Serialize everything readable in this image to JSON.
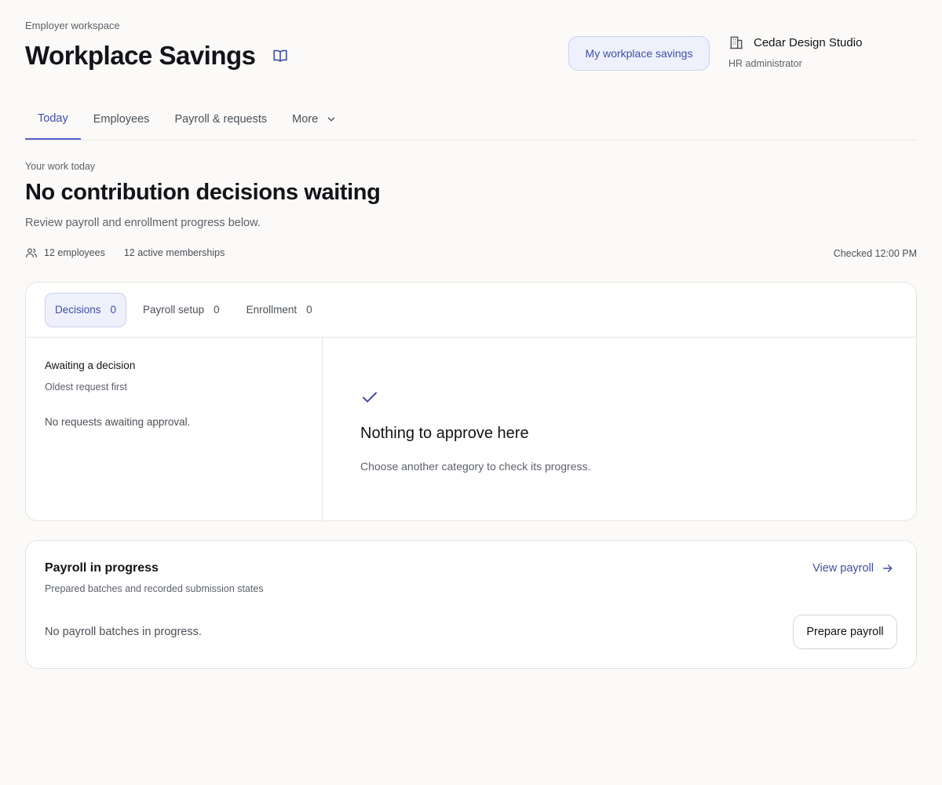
{
  "header": {
    "eyebrow": "Employer workspace",
    "title": "Workplace Savings",
    "my_savings_button": "My workplace savings",
    "org_name": "Cedar Design Studio",
    "org_role": "HR administrator"
  },
  "nav": {
    "tabs": [
      {
        "label": "Today",
        "active": true
      },
      {
        "label": "Employees"
      },
      {
        "label": "Payroll & requests"
      },
      {
        "label": "More"
      }
    ]
  },
  "summary": {
    "label": "Your work today",
    "headline": "No contribution decisions waiting",
    "subtext": "Review payroll and enrollment progress below.",
    "employees": "12 employees",
    "memberships": "12 active memberships",
    "checked": "Checked 12:00 PM"
  },
  "decisions": {
    "subtabs": [
      {
        "label": "Decisions",
        "count": "0",
        "active": true
      },
      {
        "label": "Payroll setup",
        "count": "0"
      },
      {
        "label": "Enrollment",
        "count": "0"
      }
    ],
    "list_title": "Awaiting a decision",
    "list_sub": "Oldest request first",
    "list_empty": "No requests awaiting approval.",
    "detail_title": "Nothing to approve here",
    "detail_sub": "Choose another category to check its progress."
  },
  "payroll": {
    "title": "Payroll in progress",
    "sub": "Prepared batches and recorded submission states",
    "view_link": "View payroll",
    "empty": "No payroll batches in progress.",
    "prepare_button": "Prepare payroll"
  },
  "colors": {
    "accent": "#3f4fa8",
    "accent_bg": "#eef1fb",
    "background": "#fbfaf8"
  },
  "icons": [
    "book-icon",
    "building-icon",
    "chevron-down-icon",
    "people-icon",
    "check-icon",
    "arrow-right-icon"
  ]
}
